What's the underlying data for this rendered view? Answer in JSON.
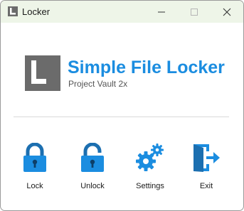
{
  "window": {
    "title": "Locker",
    "controls": {
      "minimize_icon": "minimize-icon",
      "maximize_icon": "maximize-icon",
      "close_icon": "close-icon"
    }
  },
  "header": {
    "title": "Simple File Locker",
    "subtitle": "Project Vault 2x",
    "logo_icon": "letter-l-logo"
  },
  "actions": [
    {
      "label": "Lock",
      "icon": "padlock-closed-icon"
    },
    {
      "label": "Unlock",
      "icon": "padlock-open-icon"
    },
    {
      "label": "Settings",
      "icon": "gears-icon"
    },
    {
      "label": "Exit",
      "icon": "door-exit-icon"
    }
  ],
  "colors": {
    "accent": "#1b8de0",
    "titlebar": "#eef5e8",
    "logo": "#6b6b6b"
  }
}
